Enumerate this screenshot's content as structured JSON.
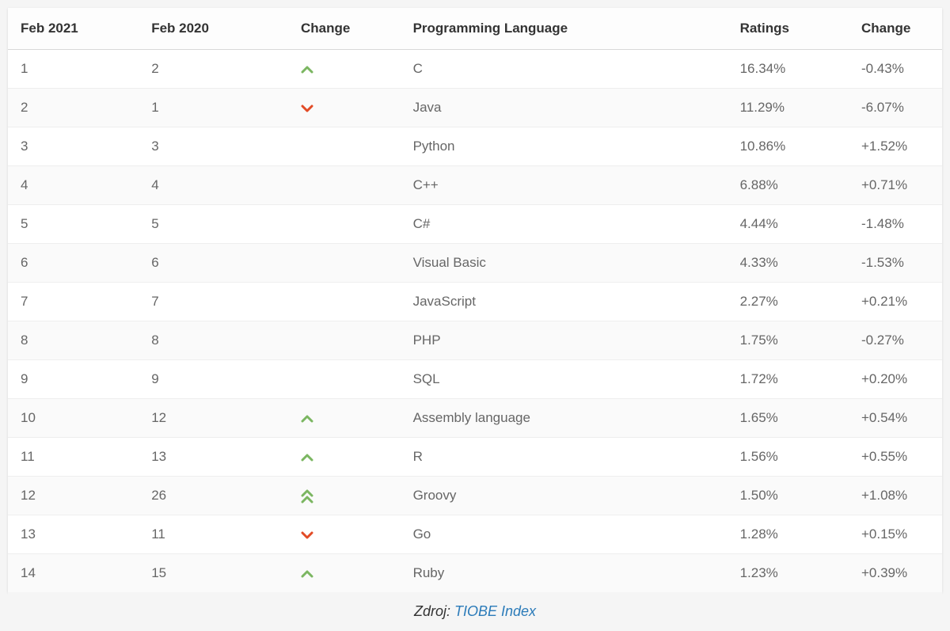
{
  "columns": {
    "feb2021": "Feb 2021",
    "feb2020": "Feb 2020",
    "change_icon": "Change",
    "language": "Programming Language",
    "ratings": "Ratings",
    "change_pct": "Change"
  },
  "icon_colors": {
    "up": "#7bb661",
    "down": "#e24b26",
    "double_up": "#7bb661"
  },
  "rows": [
    {
      "feb2021": "1",
      "feb2020": "2",
      "change_icon": "up",
      "language": "C",
      "ratings": "16.34%",
      "change_pct": "-0.43%"
    },
    {
      "feb2021": "2",
      "feb2020": "1",
      "change_icon": "down",
      "language": "Java",
      "ratings": "11.29%",
      "change_pct": "-6.07%"
    },
    {
      "feb2021": "3",
      "feb2020": "3",
      "change_icon": "",
      "language": "Python",
      "ratings": "10.86%",
      "change_pct": "+1.52%"
    },
    {
      "feb2021": "4",
      "feb2020": "4",
      "change_icon": "",
      "language": "C++",
      "ratings": "6.88%",
      "change_pct": "+0.71%"
    },
    {
      "feb2021": "5",
      "feb2020": "5",
      "change_icon": "",
      "language": "C#",
      "ratings": "4.44%",
      "change_pct": "-1.48%"
    },
    {
      "feb2021": "6",
      "feb2020": "6",
      "change_icon": "",
      "language": "Visual Basic",
      "ratings": "4.33%",
      "change_pct": "-1.53%"
    },
    {
      "feb2021": "7",
      "feb2020": "7",
      "change_icon": "",
      "language": "JavaScript",
      "ratings": "2.27%",
      "change_pct": "+0.21%"
    },
    {
      "feb2021": "8",
      "feb2020": "8",
      "change_icon": "",
      "language": "PHP",
      "ratings": "1.75%",
      "change_pct": "-0.27%"
    },
    {
      "feb2021": "9",
      "feb2020": "9",
      "change_icon": "",
      "language": "SQL",
      "ratings": "1.72%",
      "change_pct": "+0.20%"
    },
    {
      "feb2021": "10",
      "feb2020": "12",
      "change_icon": "up",
      "language": "Assembly language",
      "ratings": "1.65%",
      "change_pct": "+0.54%"
    },
    {
      "feb2021": "11",
      "feb2020": "13",
      "change_icon": "up",
      "language": "R",
      "ratings": "1.56%",
      "change_pct": "+0.55%"
    },
    {
      "feb2021": "12",
      "feb2020": "26",
      "change_icon": "double_up",
      "language": "Groovy",
      "ratings": "1.50%",
      "change_pct": "+1.08%"
    },
    {
      "feb2021": "13",
      "feb2020": "11",
      "change_icon": "down",
      "language": "Go",
      "ratings": "1.28%",
      "change_pct": "+0.15%"
    },
    {
      "feb2021": "14",
      "feb2020": "15",
      "change_icon": "up",
      "language": "Ruby",
      "ratings": "1.23%",
      "change_pct": "+0.39%"
    }
  ],
  "caption": {
    "prefix": "Zdroj: ",
    "link_text": "TIOBE Index"
  },
  "chart_data": {
    "type": "table",
    "title": "TIOBE Programming Community Index",
    "columns": [
      "Feb 2021",
      "Feb 2020",
      "Change",
      "Programming Language",
      "Ratings",
      "Change"
    ],
    "rows": [
      [
        1,
        2,
        "up",
        "C",
        16.34,
        -0.43
      ],
      [
        2,
        1,
        "down",
        "Java",
        11.29,
        -6.07
      ],
      [
        3,
        3,
        "",
        "Python",
        10.86,
        1.52
      ],
      [
        4,
        4,
        "",
        "C++",
        6.88,
        0.71
      ],
      [
        5,
        5,
        "",
        "C#",
        4.44,
        -1.48
      ],
      [
        6,
        6,
        "",
        "Visual Basic",
        4.33,
        -1.53
      ],
      [
        7,
        7,
        "",
        "JavaScript",
        2.27,
        0.21
      ],
      [
        8,
        8,
        "",
        "PHP",
        1.75,
        -0.27
      ],
      [
        9,
        9,
        "",
        "SQL",
        1.72,
        0.2
      ],
      [
        10,
        12,
        "up",
        "Assembly language",
        1.65,
        0.54
      ],
      [
        11,
        13,
        "up",
        "R",
        1.56,
        0.55
      ],
      [
        12,
        26,
        "double_up",
        "Groovy",
        1.5,
        1.08
      ],
      [
        13,
        11,
        "down",
        "Go",
        1.28,
        0.15
      ],
      [
        14,
        15,
        "up",
        "Ruby",
        1.23,
        0.39
      ]
    ]
  }
}
